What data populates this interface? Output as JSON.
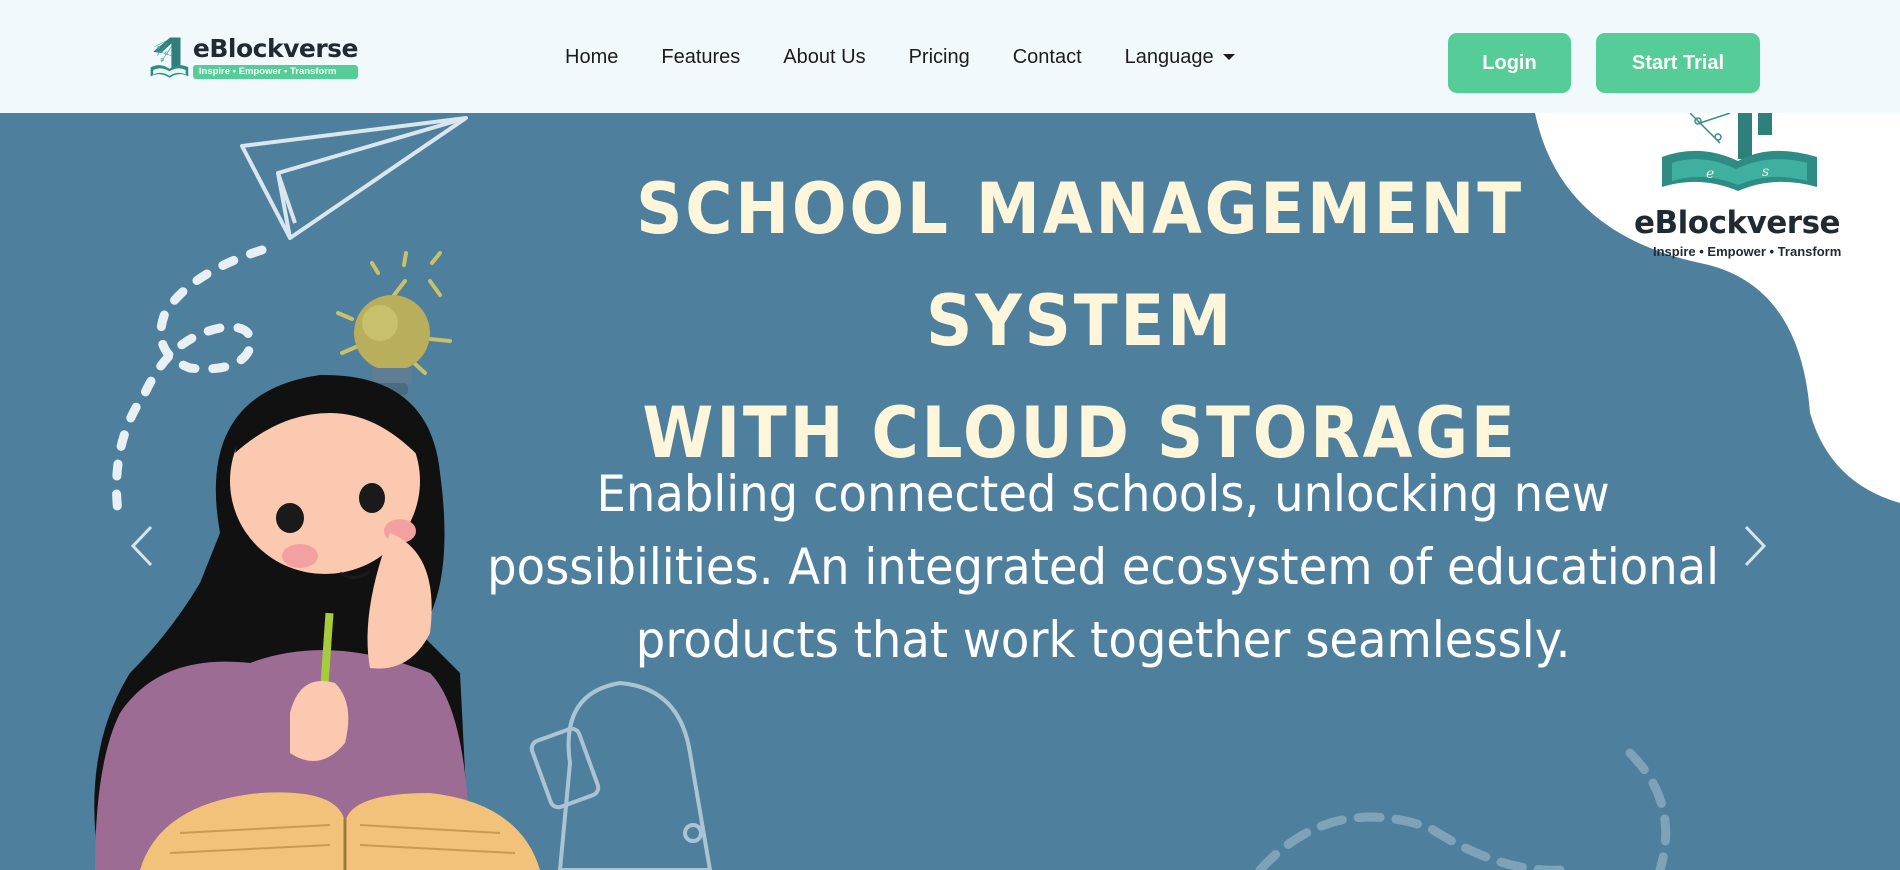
{
  "brand": {
    "name": "eBlockverse",
    "tagline": "Inspire • Empower • Transform"
  },
  "nav": {
    "links": [
      "Home",
      "Features",
      "About Us",
      "Pricing",
      "Contact"
    ],
    "language_label": "Language"
  },
  "buttons": {
    "login": "Login",
    "start_trial": "Start Trial"
  },
  "hero": {
    "title_line1": "SCHOOL MANAGEMENT SYSTEM",
    "title_line2": "WITH CLOUD STORAGE",
    "description_line1": "Enabling connected schools, unlocking new",
    "description_line2": "possibilities. An integrated ecosystem of educational",
    "description_line3": "products that work together seamlessly."
  },
  "colors": {
    "accent": "#56cc98",
    "hero_bg": "#4e7f9d",
    "title": "#fdf6da",
    "navbar_bg": "#f2f9fc"
  },
  "icons": {
    "prev": "chevron-left-icon",
    "next": "chevron-right-icon"
  }
}
